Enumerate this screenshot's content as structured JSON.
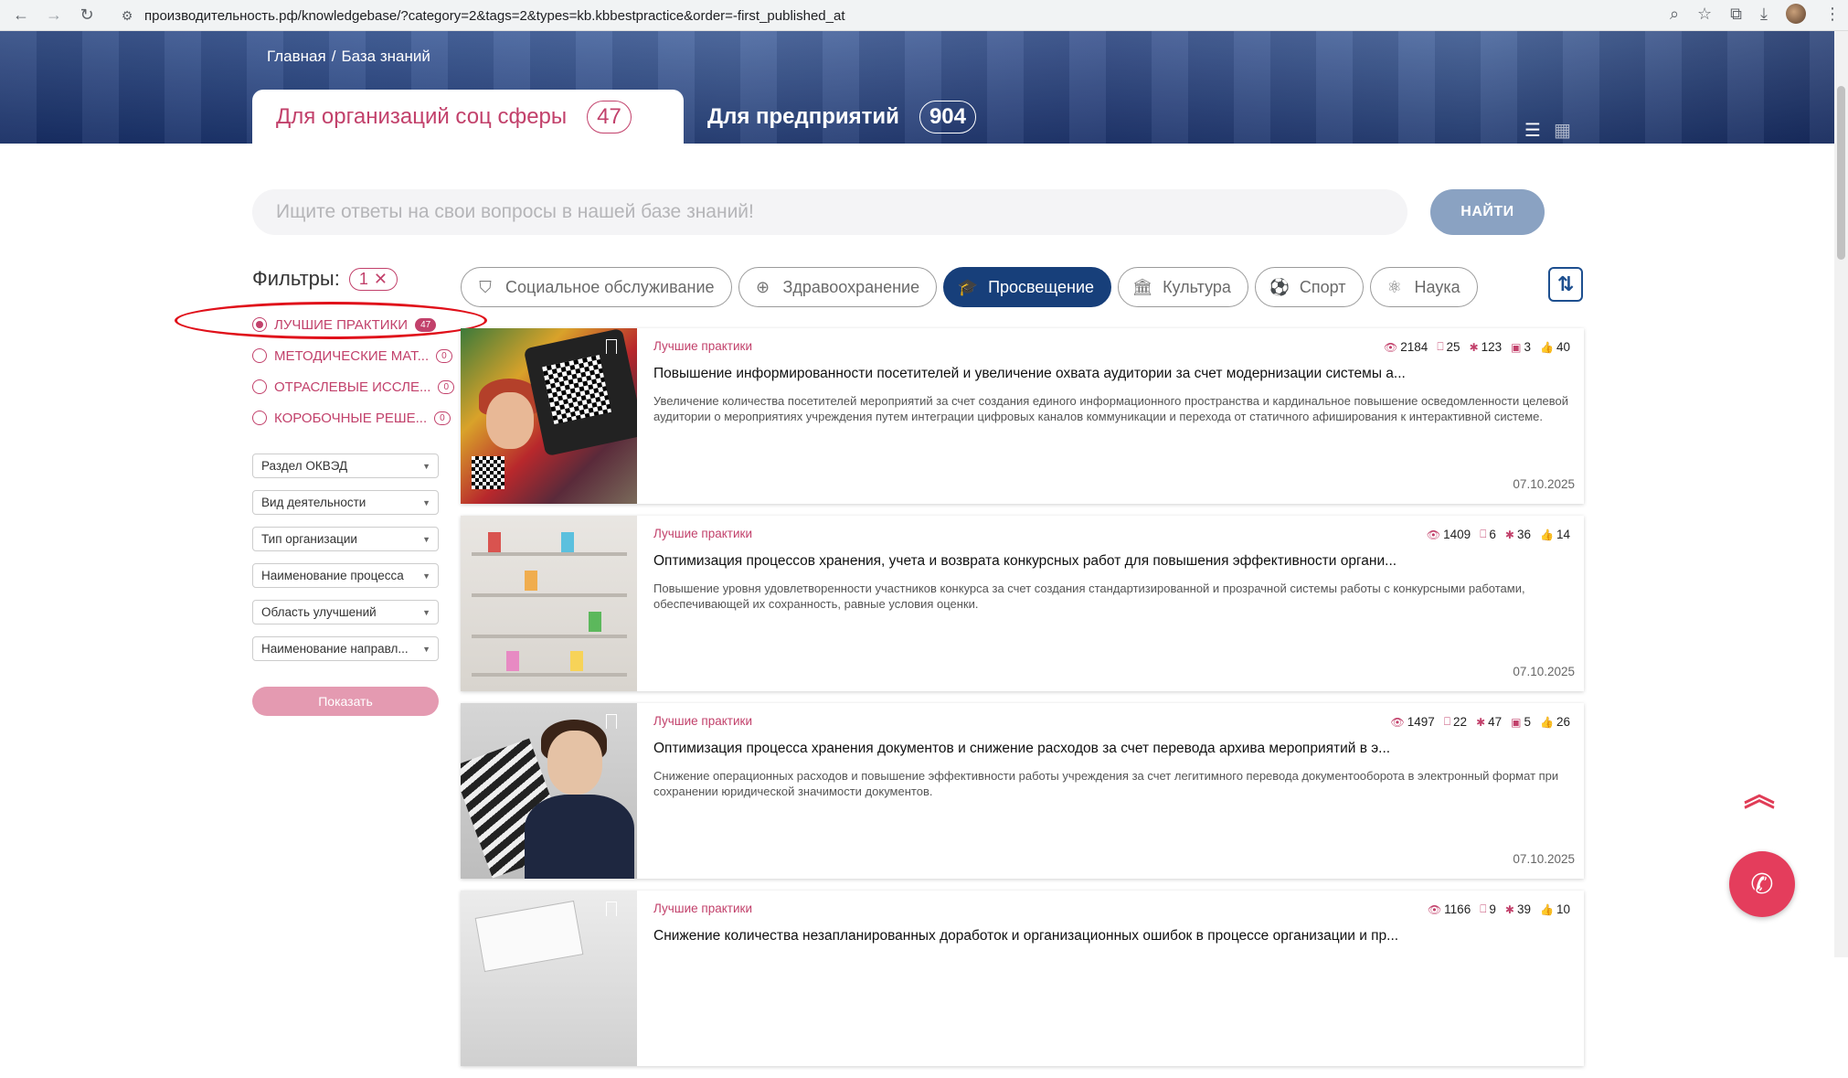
{
  "browser": {
    "url": "производительность.рф/knowledgebase/?category=2&tags=2&types=kb.kbbestpractice&order=-first_published_at"
  },
  "breadcrumb": {
    "home": "Главная",
    "separator": "/",
    "current": "База знаний"
  },
  "tabs": [
    {
      "label": "Для организаций соц сферы",
      "count": "47",
      "active": true
    },
    {
      "label": "Для предприятий",
      "count": "904",
      "active": false
    }
  ],
  "search": {
    "placeholder": "Ищите ответы на свои вопросы в нашей базе знаний!",
    "button": "НАЙТИ"
  },
  "filters": {
    "title": "Фильтры:",
    "active_count": "1",
    "clear_icon": "✕",
    "types": [
      {
        "label": "ЛУЧШИЕ ПРАКТИКИ",
        "count": "47",
        "selected": true
      },
      {
        "label": "МЕТОДИЧЕСКИЕ МАТ...",
        "count": "0",
        "selected": false
      },
      {
        "label": "ОТРАСЛЕВЫЕ ИССЛЕ...",
        "count": "0",
        "selected": false
      },
      {
        "label": "КОРОБОЧНЫЕ РЕШЕ...",
        "count": "0",
        "selected": false
      }
    ],
    "selects": [
      "Раздел ОКВЭД",
      "Вид деятельности",
      "Тип организации",
      "Наименование процесса",
      "Область улучшений",
      "Наименование направл..."
    ],
    "show_button": "Показать"
  },
  "categories": [
    {
      "label": "Социальное обслуживание",
      "icon": "shield-icon",
      "glyph": "⛉",
      "active": false
    },
    {
      "label": "Здравоохранение",
      "icon": "medical-icon",
      "glyph": "⊕",
      "active": false
    },
    {
      "label": "Просвещение",
      "icon": "graduation-cap-icon",
      "glyph": "🎓",
      "active": true
    },
    {
      "label": "Культура",
      "icon": "museum-icon",
      "glyph": "🏛",
      "active": false
    },
    {
      "label": "Спорт",
      "icon": "ball-icon",
      "glyph": "⚽",
      "active": false
    },
    {
      "label": "Наука",
      "icon": "molecule-icon",
      "glyph": "⚛",
      "active": false
    }
  ],
  "cards": [
    {
      "type": "Лучшие практики",
      "title": "Повышение информированности посетителей и увеличение охвата аудитории за счет модернизации системы а...",
      "description": "Увеличение количества посетителей мероприятий за счет создания единого информационного пространства и кардинальное повышение осведомленности целевой аудитории о мероприятиях учреждения путем интеграции цифровых каналов коммуникации и перехода от статичного афиширования к интерактивной системе.",
      "views": "2184",
      "bookmarks": "25",
      "rating": "123",
      "docs": "3",
      "likes": "40",
      "date": "07.10.2025"
    },
    {
      "type": "Лучшие практики",
      "title": "Оптимизация процессов хранения, учета и возврата конкурсных работ для повышения эффективности органи...",
      "description": "Повышение уровня удовлетворенности участников конкурса за счет создания стандартизированной и прозрачной системы работы с конкурсными работами, обеспечивающей их сохранность, равные условия оценки.",
      "views": "1409",
      "bookmarks": "6",
      "rating": "36",
      "docs": "",
      "likes": "14",
      "date": "07.10.2025"
    },
    {
      "type": "Лучшие практики",
      "title": "Оптимизация процесса хранения документов и снижение расходов за счет перевода архива мероприятий в э...",
      "description": "Снижение операционных расходов и повышение эффективности работы учреждения за счет легитимного перевода документооборота в электронный формат при сохранении юридической значимости документов.",
      "views": "1497",
      "bookmarks": "22",
      "rating": "47",
      "docs": "5",
      "likes": "26",
      "date": "07.10.2025"
    },
    {
      "type": "Лучшие практики",
      "title": "Снижение количества незапланированных доработок и организационных ошибок в процессе организации и пр...",
      "description": "",
      "views": "1166",
      "bookmarks": "9",
      "rating": "39",
      "docs": "",
      "likes": "10",
      "date": ""
    }
  ]
}
